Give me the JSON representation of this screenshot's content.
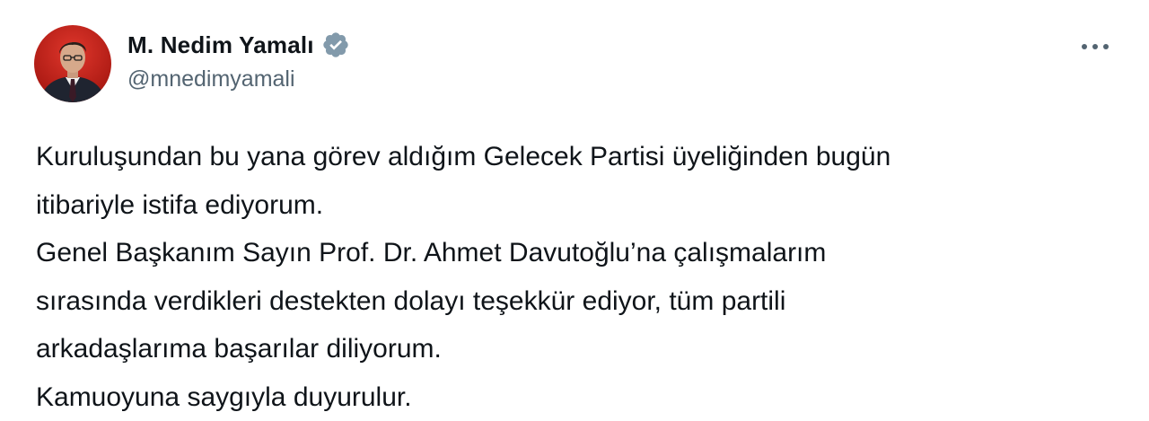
{
  "author": {
    "display_name": "M. Nedim Yamalı",
    "handle": "@mnedimyamali",
    "verified": true,
    "avatar": "profile-photo"
  },
  "actions": {
    "more_icon": "more-horizontal-icon"
  },
  "tweet": {
    "lines": [
      "Kuruluşundan bu yana görev aldığım Gelecek Partisi üyeliğinden bugün",
      "itibariyle istifa ediyorum.",
      "Genel Başkanım Sayın Prof. Dr. Ahmet Davutoğlu’na çalışmalarım",
      "sırasında verdikleri destekten dolayı teşekkür ediyor, tüm partili",
      "arkadaşlarıma başarılar diliyorum.",
      "Kamuoyuna saygıyla duyurulur."
    ]
  },
  "colors": {
    "text": "#0f1419",
    "secondary_text": "#536471",
    "verified_badge": "#829aab",
    "avatar_background": "#c0211c"
  }
}
